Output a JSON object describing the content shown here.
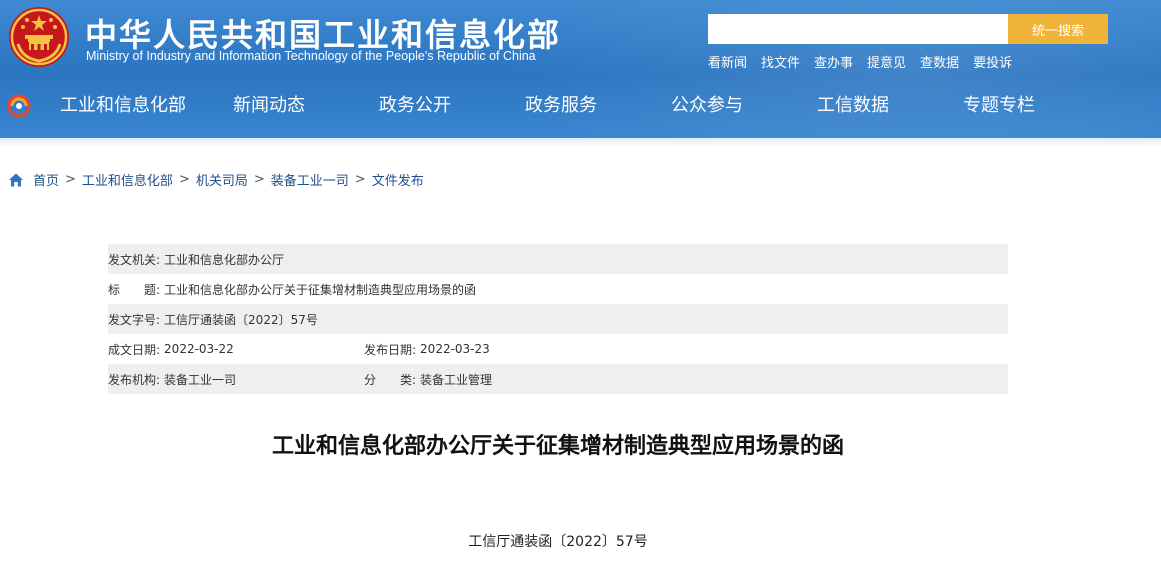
{
  "header": {
    "title_cn": "中华人民共和国工业和信息化部",
    "title_en": "Ministry of Industry and Information Technology of the People's Republic of China",
    "emblem_icon": "national-emblem-icon",
    "colors": {
      "header_bg": "#2a74c1",
      "accent": "#f0b33a"
    }
  },
  "search": {
    "placeholder": "",
    "value": "",
    "button_label": "统一搜索"
  },
  "quick_links": [
    "看新闻",
    "找文件",
    "查办事",
    "提意见",
    "查数据",
    "要投诉"
  ],
  "nav": {
    "logo_icon": "site-logo-icon",
    "items": [
      "工业和信息化部",
      "新闻动态",
      "政务公开",
      "政务服务",
      "公众参与",
      "工信数据",
      "专题专栏"
    ]
  },
  "breadcrumb": {
    "home_icon": "home-icon",
    "items": [
      "首页",
      "工业和信息化部",
      "机关司局",
      "装备工业一司",
      "文件发布"
    ],
    "separator": ">"
  },
  "doc_info": {
    "issuer_label": "发文机关:",
    "issuer": "工业和信息化部办公厅",
    "title_label": "标　　题:",
    "title": "工业和信息化部办公厅关于征集增材制造典型应用场景的函",
    "number_label": "发文字号:",
    "number": "工信厅通装函〔2022〕57号",
    "written_date_label": "成文日期:",
    "written_date": "2022-03-22",
    "publish_date_label": "发布日期:",
    "publish_date": "2022-03-23",
    "org_label": "发布机构:",
    "org": "装备工业一司",
    "category_label": "分　　类:",
    "category": "装备工业管理"
  },
  "document": {
    "title": "工业和信息化部办公厅关于征集增材制造典型应用场景的函",
    "number": "工信厅通装函〔2022〕57号"
  }
}
